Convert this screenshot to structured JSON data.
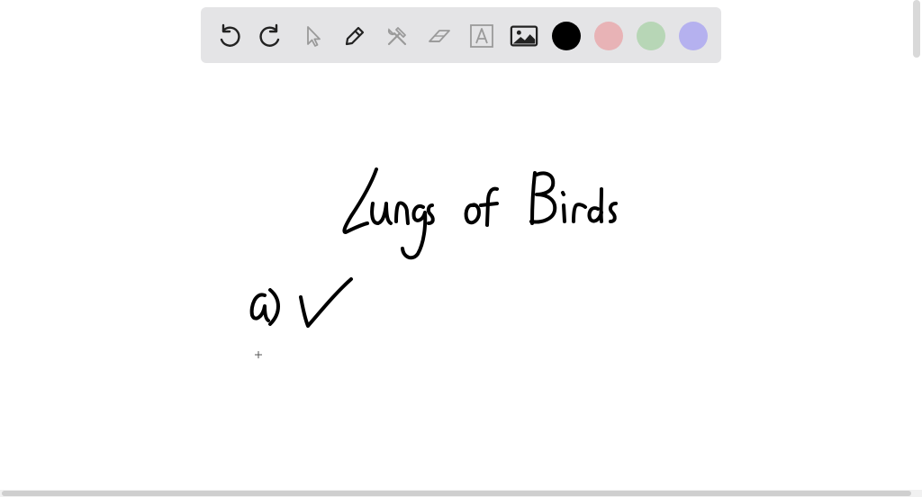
{
  "toolbar": {
    "tools": [
      {
        "name": "undo-icon"
      },
      {
        "name": "redo-icon"
      },
      {
        "name": "select-arrow-icon"
      },
      {
        "name": "pen-icon"
      },
      {
        "name": "tools-icon"
      },
      {
        "name": "eraser-icon"
      },
      {
        "name": "text-icon"
      },
      {
        "name": "image-icon"
      }
    ],
    "colors": [
      "#000000",
      "#e8b3b6",
      "#b7d6b6",
      "#b5b1ef"
    ],
    "selected_color": "#000000"
  },
  "canvas": {
    "handwritten_title": "Lungs of Birds",
    "handwritten_item": "a)"
  }
}
